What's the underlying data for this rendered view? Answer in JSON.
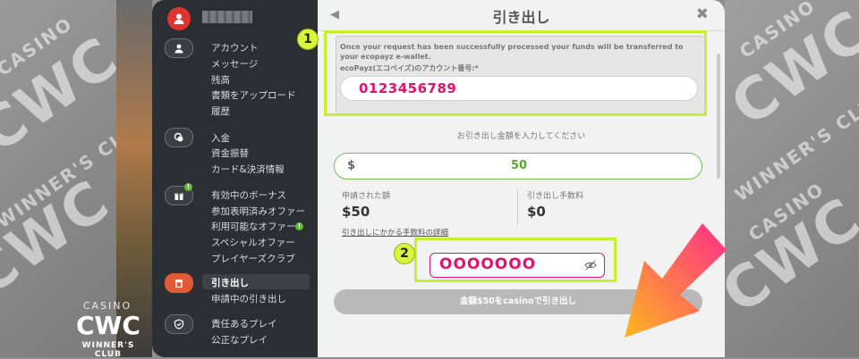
{
  "watermark": {
    "casino": "CASINO",
    "cwc": "CWC",
    "club": "WINNER'S CLUB"
  },
  "sidebar": {
    "username": "",
    "groups": [
      {
        "icon": "user-icon",
        "items": [
          "アカウント",
          "メッセージ",
          "残高",
          "書類をアップロード",
          "履歴"
        ]
      },
      {
        "icon": "coins-icon",
        "items": [
          "入金",
          "資金振替",
          "カード&決済情報"
        ]
      },
      {
        "icon": "bonus-icon",
        "items": [
          "有効中のボーナス",
          "参加表明済みオファー",
          "利用可能なオファー",
          "スペシャルオファー",
          "プレイヤーズクラブ"
        ]
      },
      {
        "icon": "withdraw-icon",
        "items": [
          "引き出し",
          "申請中の引き出し"
        ]
      },
      {
        "icon": "shield-icon",
        "items": [
          "責任あるプレイ",
          "公正なプレイ"
        ]
      }
    ]
  },
  "panel": {
    "title": "引き出し",
    "back": "◀",
    "close": "✖",
    "account_note": "Once your request has been successfully processed your funds will be transferred to your ecopayz e-wallet.",
    "account_label": "ecoPayz(エコペイズ)のアカウント番号:*",
    "account_value": "0123456789",
    "amount_label": "お引き出し金額を入力してください",
    "currency": "$",
    "amount_value": "50",
    "requested_label": "申請された額",
    "requested_value": "$50",
    "fee_label": "引き出し手数料",
    "fee_value": "$0",
    "fee_link": "引き出しにかかる手数料の詳細",
    "password_value": "OOOOOOO",
    "submit_label": "金額$50をcasinoで引き出し"
  },
  "annotations": {
    "step1": "1",
    "step2": "2"
  },
  "logo": {
    "top": "CASINO",
    "main": "CWC",
    "sub": "WINNER'S CLUB"
  },
  "colors": {
    "accent": "#e2136e",
    "highlight": "#c5f02c",
    "arrow_start": "#ff2e8a",
    "arrow_end": "#ffb51f"
  }
}
